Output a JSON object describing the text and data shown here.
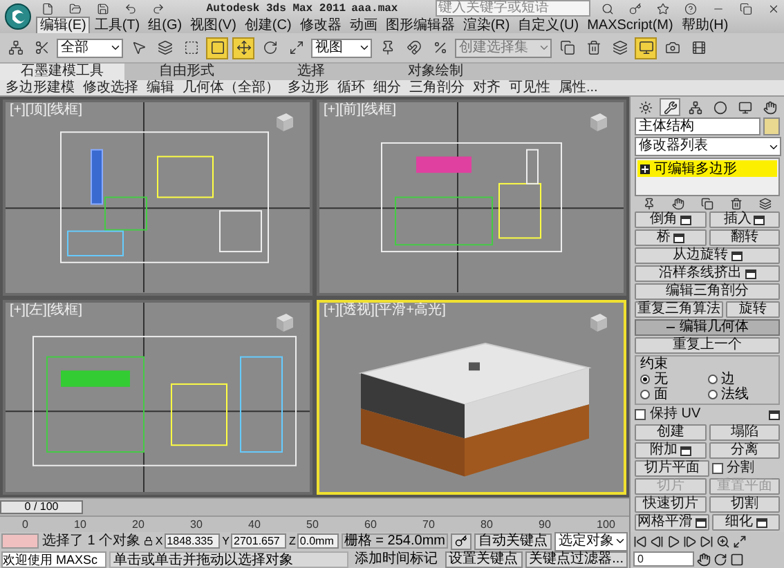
{
  "title_bar": {
    "app_title": "Autodesk 3ds Max  2011",
    "file_name": "aaa.max",
    "search": {
      "placeholder": "键入关键字或短语"
    }
  },
  "menu": [
    {
      "label": "编辑(E)",
      "selected": true
    },
    {
      "label": "工具(T)",
      "selected": false
    },
    {
      "label": "组(G)",
      "selected": false
    },
    {
      "label": "视图(V)",
      "selected": false
    },
    {
      "label": "创建(C)",
      "selected": false
    },
    {
      "label": "修改器",
      "selected": false
    },
    {
      "label": "动画",
      "selected": false
    },
    {
      "label": "图形编辑器",
      "selected": false
    },
    {
      "label": "渲染(R)",
      "selected": false
    },
    {
      "label": "自定义(U)",
      "selected": false
    },
    {
      "label": "MAXScript(M)",
      "selected": false
    },
    {
      "label": "帮助(H)",
      "selected": false
    }
  ],
  "toolbar": {
    "selection_filter": "全部",
    "reference_coordinate": "视图",
    "named_selection": {
      "placeholder": "创建选择集"
    }
  },
  "ribbon": {
    "tabs": [
      {
        "label": "石墨建模工具",
        "selected": true
      },
      {
        "label": "自由形式",
        "selected": false
      },
      {
        "label": "选择",
        "selected": false
      },
      {
        "label": "对象绘制",
        "selected": false
      }
    ],
    "panels": [
      "多边形建模",
      "修改选择",
      "编辑",
      "几何体（全部）",
      "多边形",
      "循环",
      "细分",
      "三角剖分",
      "对齐",
      "可见性",
      "属性..."
    ]
  },
  "viewports": [
    {
      "label": "[+][顶][线框]",
      "kind": "top",
      "active": false
    },
    {
      "label": "[+][前][线框]",
      "kind": "front",
      "active": false
    },
    {
      "label": "[+][左][线框]",
      "kind": "left",
      "active": false
    },
    {
      "label": "[+][透视][平滑+高光]",
      "kind": "perspective",
      "active": true
    }
  ],
  "time_slider": {
    "label": "0 / 100",
    "level": 0
  },
  "ruler": {
    "ticks": [
      "0",
      "10",
      "20",
      "30",
      "40",
      "50",
      "60",
      "70",
      "80",
      "90",
      "100"
    ]
  },
  "command_panel": {
    "object_name": "主体结构",
    "modifier_list": "修改器列表",
    "stack": [
      {
        "label": "可编辑多边形",
        "selected": true
      }
    ],
    "rows": [
      [
        {
          "kind": "button",
          "label": "倒角",
          "settings": true,
          "disabled": false
        },
        {
          "kind": "button",
          "label": "插入",
          "settings": true,
          "disabled": false
        }
      ],
      [
        {
          "kind": "button",
          "label": "桥",
          "settings": true,
          "disabled": false
        },
        {
          "kind": "button",
          "label": "翻转",
          "settings": false,
          "disabled": false
        }
      ],
      [
        {
          "kind": "button",
          "label": "从边旋转",
          "settings": true,
          "disabled": false
        }
      ],
      [
        {
          "kind": "button",
          "label": "沿样条线挤出",
          "settings": true,
          "disabled": false
        }
      ],
      [
        {
          "kind": "button",
          "label": "编辑三角剖分",
          "settings": false,
          "disabled": false
        }
      ],
      [
        {
          "kind": "button",
          "label": "重复三角算法",
          "settings": false,
          "disabled": false
        },
        {
          "kind": "button",
          "label": "旋转",
          "settings": false,
          "disabled": false
        }
      ]
    ],
    "rollout": {
      "title": "编辑几何体",
      "expanded": true,
      "top_rows": [
        [
          {
            "kind": "button",
            "label": "重复上一个",
            "settings": false,
            "disabled": false
          }
        ]
      ],
      "constraints": {
        "title": "约束",
        "options": [
          {
            "label": "无",
            "selected": true
          },
          {
            "label": "边",
            "selected": false
          },
          {
            "label": "面",
            "selected": false
          },
          {
            "label": "法线",
            "selected": false
          }
        ]
      },
      "rows": [
        [
          {
            "kind": "checkbox",
            "label": "保持 UV",
            "checked": false,
            "settings": true
          }
        ],
        [
          {
            "kind": "button",
            "label": "创建",
            "settings": false,
            "disabled": false
          },
          {
            "kind": "button",
            "label": "塌陷",
            "settings": false,
            "disabled": false
          }
        ],
        [
          {
            "kind": "button",
            "label": "附加",
            "settings": true,
            "disabled": false
          },
          {
            "kind": "button",
            "label": "分离",
            "settings": false,
            "disabled": false
          }
        ],
        [
          {
            "kind": "button",
            "label": "切片平面",
            "settings": false,
            "disabled": false
          },
          {
            "kind": "checkbox",
            "label": "分割",
            "checked": false,
            "settings": false
          }
        ],
        [
          {
            "kind": "button",
            "label": "切片",
            "settings": false,
            "disabled": true
          },
          {
            "kind": "button",
            "label": "重置平面",
            "settings": false,
            "disabled": true
          }
        ],
        [
          {
            "kind": "button",
            "label": "快速切片",
            "settings": false,
            "disabled": false
          },
          {
            "kind": "button",
            "label": "切割",
            "settings": false,
            "disabled": false
          }
        ],
        [
          {
            "kind": "button",
            "label": "网格平滑",
            "settings": true,
            "disabled": false
          },
          {
            "kind": "button",
            "label": "细化",
            "settings": true,
            "disabled": false
          }
        ]
      ]
    }
  },
  "status": {
    "welcome": "欢迎使用 MAXSc",
    "selection_info": "选择了 1 个对象",
    "prompt": "单击或单击并拖动以选择对象",
    "coords": [
      {
        "axis": "X",
        "value": "1848.335"
      },
      {
        "axis": "Y",
        "value": "2701.657"
      },
      {
        "axis": "Z",
        "value": "0.0mm"
      }
    ],
    "grid": "栅格 = 254.0mm",
    "add_time_tag": "添加时间标记",
    "auto_key": "自动关键点",
    "key_mode": "选定对象",
    "set_key": "设置关键点",
    "key_filters": "关键点过滤器...",
    "current_frame": "0"
  }
}
